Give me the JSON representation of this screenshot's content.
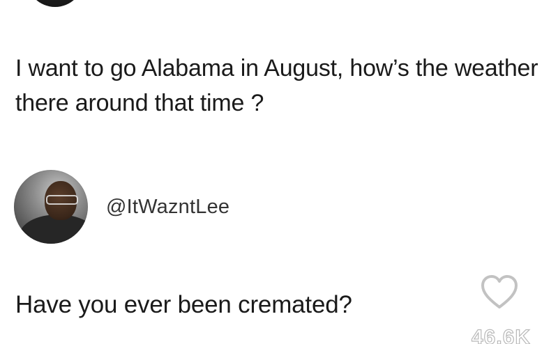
{
  "post": {
    "text": "I want to go Alabama in August, how’s the weather there around that time ?"
  },
  "reply": {
    "handle": "@ItWazntLee",
    "text": "Have you ever been cremated?"
  },
  "likes": {
    "count": "46.6K"
  },
  "icons": {
    "like": "heart-outline-icon"
  }
}
